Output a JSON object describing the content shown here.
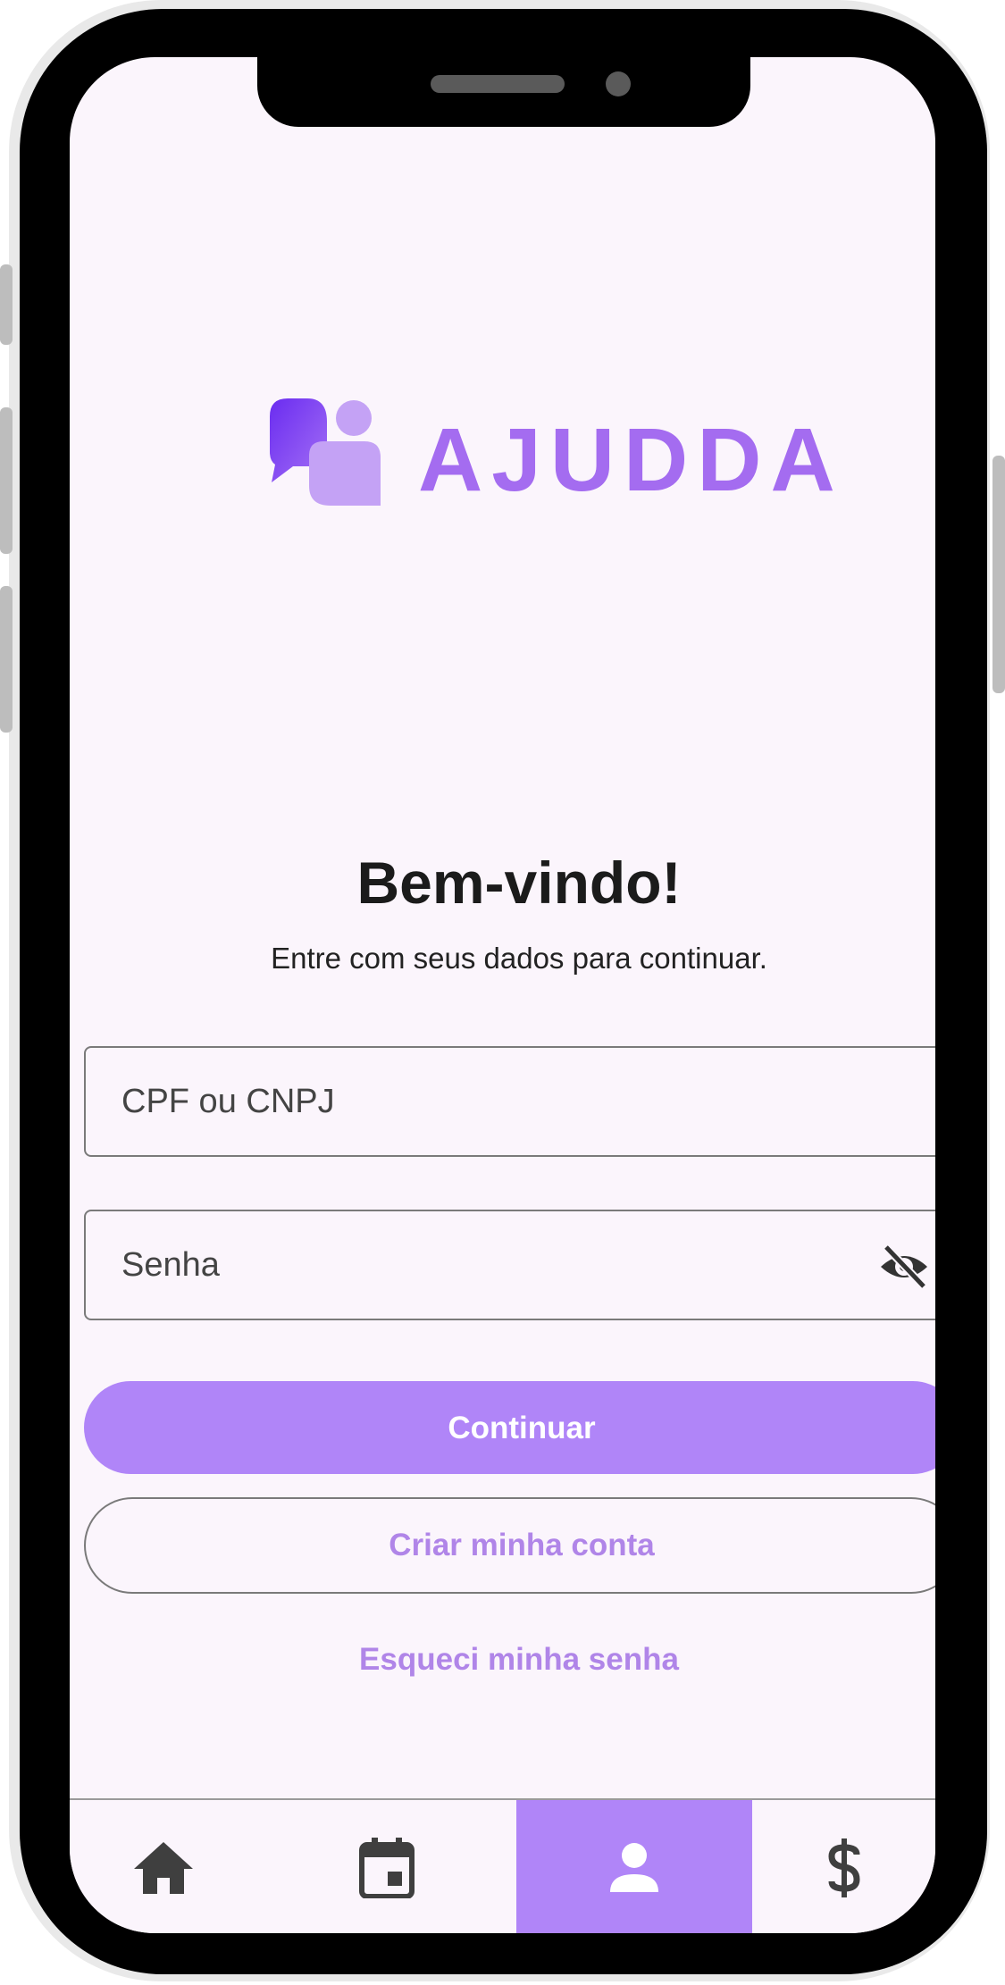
{
  "app": {
    "logo_text": "AJUDDA",
    "brand_colors": {
      "primary": "#b085f8",
      "logo_light": "#c4a2f5",
      "logo_dark": "#7b3ff0"
    }
  },
  "welcome": {
    "title": "Bem-vindo!",
    "subtitle": "Entre com seus dados para continuar."
  },
  "form": {
    "document_field": {
      "placeholder": "CPF ou CNPJ",
      "value": ""
    },
    "password_field": {
      "placeholder": "Senha",
      "value": "",
      "toggle_icon": "eye-off-icon"
    },
    "continue_label": "Continuar",
    "create_account_label": "Criar minha conta",
    "forgot_password_label": "Esqueci minha senha"
  },
  "bottom_nav": {
    "items": [
      {
        "icon": "home-icon",
        "active": false
      },
      {
        "icon": "calendar-icon",
        "active": false
      },
      {
        "icon": "person-icon",
        "active": true
      },
      {
        "icon": "dollar-icon",
        "active": false
      }
    ]
  }
}
